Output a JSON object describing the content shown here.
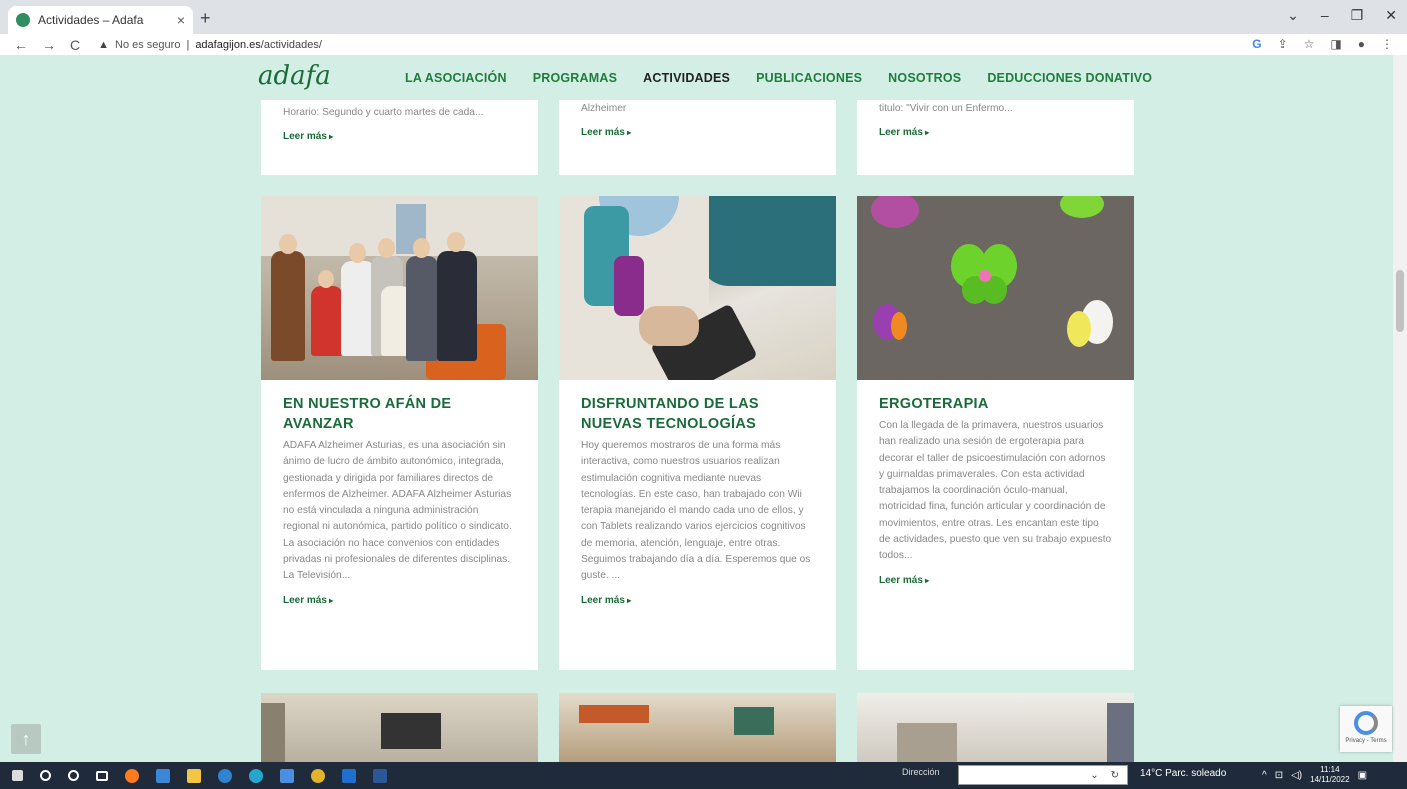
{
  "browser": {
    "tab_title": "Actividades – Adafa",
    "tab_close": "×",
    "new_tab": "+",
    "window_controls": [
      "⌄",
      "–",
      "❐",
      "✕"
    ],
    "nav_buttons": [
      "←",
      "→",
      "C"
    ],
    "security_label": "No es seguro",
    "url_domain": "adafagijon.es",
    "url_path": "/actividades/",
    "toolbar_icons": [
      "G",
      "⇪",
      "☆",
      "◨",
      "●",
      "⋮"
    ]
  },
  "site": {
    "logo": "adafa",
    "menu": [
      {
        "label": "LA ASOCIACIÓN"
      },
      {
        "label": "PROGRAMAS"
      },
      {
        "label": "ACTIVIDADES"
      },
      {
        "label": "PUBLICACIONES"
      },
      {
        "label": "NOSOTROS"
      },
      {
        "label": "DEDUCCIONES DONATIVO"
      }
    ]
  },
  "top_cards": [
    {
      "text": "Horario: Segundo y cuarto martes de cada...",
      "read_more": "Leer más"
    },
    {
      "text": "Alzheimer",
      "read_more": "Leer más"
    },
    {
      "text": "titulo: \"Vivir con un Enfermo...",
      "read_more": "Leer más"
    }
  ],
  "cards": [
    {
      "title": "EN NUESTRO AFÁN DE\nAVANZAR",
      "text": "ADAFA Alzheimer Asturias, es una asociación sin ánimo de lucro de ámbito autonómico, integrada, gestionada y dirigida por familiares directos de enfermos de Alzheimer. ADAFA Alzheimer Asturias no está vinculada a ninguna administración regional ni autonómica, partido político o sindicato. La asociación no hace convenios con entidades privadas ni profesionales de diferentes disciplinas. La Televisión...",
      "read_more": "Leer más"
    },
    {
      "title": "DISFRUNTANDO DE LAS\nNUEVAS TECNOLOGÍAS",
      "text": "Hoy queremos mostraros de una forma más interactiva, como nuestros usuarios realizan estimulación cognitiva mediante nuevas tecnologías. En este caso, han trabajado con Wii terapia manejando el mando cada uno de ellos, y con Tablets realizando varios ejercicios cognitivos de memoria, atención, lenguaje, entre otras. Seguimos trabajando día a día. Esperemos que os guste. ...",
      "read_more": "Leer más"
    },
    {
      "title": "ERGOTERAPIA",
      "text": "Con la llegada de la primavera, nuestros usuarios han realizado una sesión de ergoterapia para decorar el taller de psicoestimulación con adornos y guirnaldas primaverales. Con esta actividad trabajamos la coordinación óculo-manual, motricidad fina, función articular y coordinación de movimientos, entre otras. Les encantan este tipo de actividades, puesto que ven su trabajo expuesto todos...",
      "read_more": "Leer más"
    }
  ],
  "scroll_up": "↑",
  "recaptcha_text": "Privacy - Terms",
  "taskbar": {
    "address_label": "Dirección",
    "weather": "14°C  Parc. soleado",
    "time": "11:14",
    "date": "14/11/2022"
  }
}
